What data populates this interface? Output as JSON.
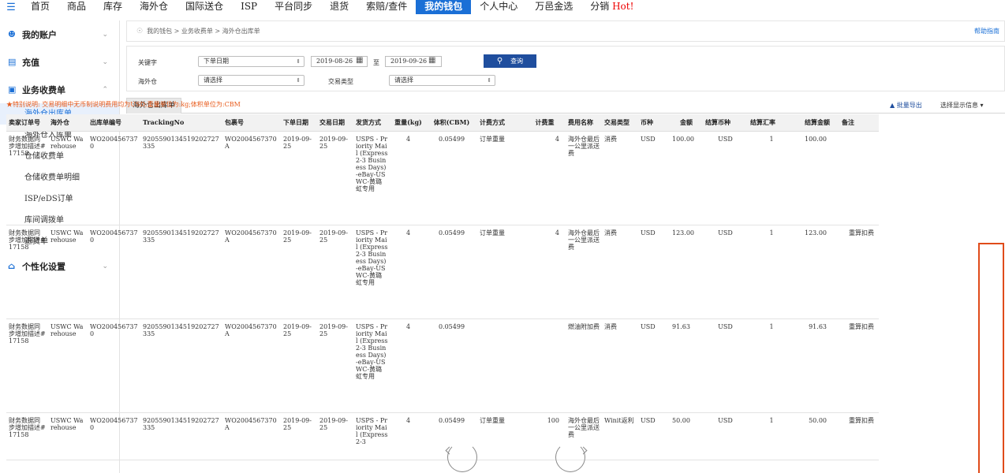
{
  "topnav": {
    "items": [
      "首页",
      "商品",
      "库存",
      "海外仓",
      "国际送仓",
      "ISP",
      "平台同步",
      "退货",
      "索赔/查件",
      "我的钱包",
      "个人中心",
      "万邑金选",
      "分销"
    ],
    "active_index": 9,
    "hot_label": "Hot!"
  },
  "sidebar": {
    "groups": [
      {
        "label": "我的账户",
        "icon": "user-icon"
      },
      {
        "label": "充值",
        "icon": "recharge-icon"
      },
      {
        "label": "业务收费单",
        "icon": "bill-icon"
      },
      {
        "label": "个性化设置",
        "icon": "home-icon"
      }
    ],
    "subitems": [
      "海外仓出库单",
      "海外仓入库单",
      "仓储收费单",
      "仓储收费单明细",
      "ISP/eDS订单",
      "库间调拨单",
      "退货单"
    ],
    "active_sub": 0
  },
  "breadcrumb": {
    "text": "我的钱包 > 业务收费单 > 海外仓出库单",
    "help": "帮助指南"
  },
  "filters": {
    "keyword_label": "关键字",
    "date_type": "下单日期",
    "date_from": "2019-08-26",
    "to_label": "至",
    "date_to": "2019-09-26",
    "search_label": "查询",
    "warehouse_label": "海外仓",
    "warehouse_value": "请选择",
    "txn_type_label": "交易类型",
    "txn_type_value": "请选择"
  },
  "tab_label": "海外仓出库单",
  "export_label": "批量导出",
  "display_label": "选择显示信息",
  "notice": "特别说明: 交易明细中无币制说明费用均为USD;重量单位为:kg;体积单位为:CBM",
  "table": {
    "columns": [
      "卖家订单号",
      "海外仓",
      "出库单编号",
      "TrackingNo",
      "包裹号",
      "下单日期",
      "交易日期",
      "发货方式",
      "重量(kg)",
      "体积(CBM)",
      "计费方式",
      "计费重",
      "费用名称",
      "交易类型",
      "币种",
      "金额",
      "结算币种",
      "结算汇率",
      "结算金额",
      "备注"
    ],
    "rows": [
      [
        "财务数据同步增加描述#17158",
        "USWC Warehouse",
        "WO2004567370",
        "9205590134519202727335",
        "WO2004567370A",
        "2019-09-25",
        "2019-09-25",
        "USPS - Priority Mail (Express 2-3 Business Days)-eBay-USWC-黄璐虹专用",
        "4",
        "0.05499",
        "订单重量",
        "4",
        "海外仓最后一公里派送费",
        "消费",
        "USD",
        "100.00",
        "USD",
        "1",
        "100.00",
        ""
      ],
      [
        "财务数据同步增加描述#17158",
        "USWC Warehouse",
        "WO2004567370",
        "9205590134519202727335",
        "WO2004567370A",
        "2019-09-25",
        "2019-09-25",
        "USPS - Priority Mail (Express 2-3 Business Days)-eBay-USWC-黄璐虹专用",
        "4",
        "0.05499",
        "订单重量",
        "4",
        "海外仓最后一公里派送费",
        "消费",
        "USD",
        "123.00",
        "USD",
        "1",
        "123.00",
        "重算扣费"
      ],
      [
        "财务数据同步增加描述#17158",
        "USWC Warehouse",
        "WO2004567370",
        "9205590134519202727335",
        "WO2004567370A",
        "2019-09-25",
        "2019-09-25",
        "USPS - Priority Mail (Express 2-3 Business Days)-eBay-USWC-黄璐虹专用",
        "4",
        "0.05499",
        "",
        "",
        "燃油附加费",
        "消费",
        "USD",
        "91.63",
        "USD",
        "1",
        "91.63",
        "重算扣费"
      ],
      [
        "财务数据同步增加描述#17158",
        "USWC Warehouse",
        "WO2004567370",
        "9205590134519202727335",
        "WO2004567370A",
        "2019-09-25",
        "2019-09-25",
        "USPS - Priority Mail (Express 2-3",
        "4",
        "0.05499",
        "订单重量",
        "100",
        "海外仓最后一公里派送费",
        "Winit返利",
        "USD",
        "50.00",
        "USD",
        "1",
        "50.00",
        "重算扣费"
      ]
    ]
  },
  "colors": {
    "primary": "#1a6fd6",
    "search_button": "#1f4e9e",
    "highlight_box": "#e04b1a",
    "notice": "#e85a1a"
  }
}
